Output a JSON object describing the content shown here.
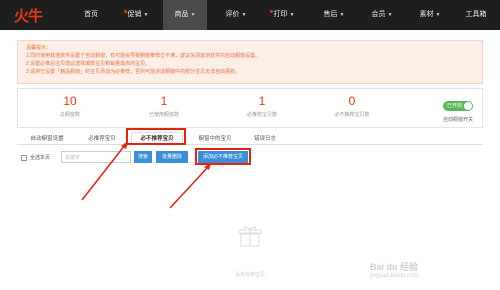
{
  "app": {
    "logo": "火牛"
  },
  "nav": {
    "items": [
      {
        "label": "首页",
        "dot": false,
        "caret": false,
        "active": false
      },
      {
        "label": "促销",
        "dot": true,
        "caret": true,
        "active": false
      },
      {
        "label": "商品",
        "dot": false,
        "caret": true,
        "active": true
      },
      {
        "label": "评价",
        "dot": false,
        "caret": true,
        "active": false
      },
      {
        "label": "打印",
        "dot": true,
        "caret": true,
        "active": false
      },
      {
        "label": "售后",
        "dot": false,
        "caret": true,
        "active": false
      },
      {
        "label": "会员",
        "dot": false,
        "caret": true,
        "active": false
      },
      {
        "label": "素材",
        "dot": false,
        "caret": true,
        "active": false
      },
      {
        "label": "工具箱",
        "dot": false,
        "caret": false,
        "active": false
      }
    ]
  },
  "notice": {
    "title": "温馨提示：",
    "lines": [
      "1.同时使用其他软件设置了自动橱窗，有可能会导致橱窗推荐位不满，建议关闭其他软件的自动橱窗设置。",
      "2.设置必推后宝贝建议选择爆款宝贝和销量最高的宝贝。",
      "3.请将已设置「精品橱窗」的宝贝添加为必推荐，否则可能造成橱窗中的部分宝贝无法自动更新。"
    ]
  },
  "stats": [
    {
      "value": "10",
      "label": "总橱窗数"
    },
    {
      "value": "1",
      "label": "已使用橱窗数"
    },
    {
      "value": "1",
      "label": "必推荐宝贝数"
    },
    {
      "value": "0",
      "label": "必不推荐宝贝数"
    }
  ],
  "auto_toggle": {
    "state_label": "已开启",
    "label": "自动橱窗开关"
  },
  "tabs": [
    {
      "label": "自动橱窗设置",
      "active": false
    },
    {
      "label": "必推荐宝贝",
      "active": false
    },
    {
      "label": "必不推荐宝贝",
      "active": true
    },
    {
      "label": "橱窗中的宝贝",
      "active": false
    },
    {
      "label": "错误日志",
      "active": false
    }
  ],
  "toolbar": {
    "select_all": "全选本页",
    "search_placeholder": "关键字",
    "search_button": "搜索",
    "batch_delete": "批量删除",
    "add_button": "添加必不推荐宝贝"
  },
  "empty": {
    "text": "没有找到宝贝"
  },
  "watermark": {
    "brand": "Bai du 经验",
    "url": "jingyan.baidu.com"
  },
  "colors": {
    "accent": "#e8380d",
    "button": "#3b8fd8",
    "toggle": "#5cb85c",
    "highlight": "#e8230d"
  }
}
